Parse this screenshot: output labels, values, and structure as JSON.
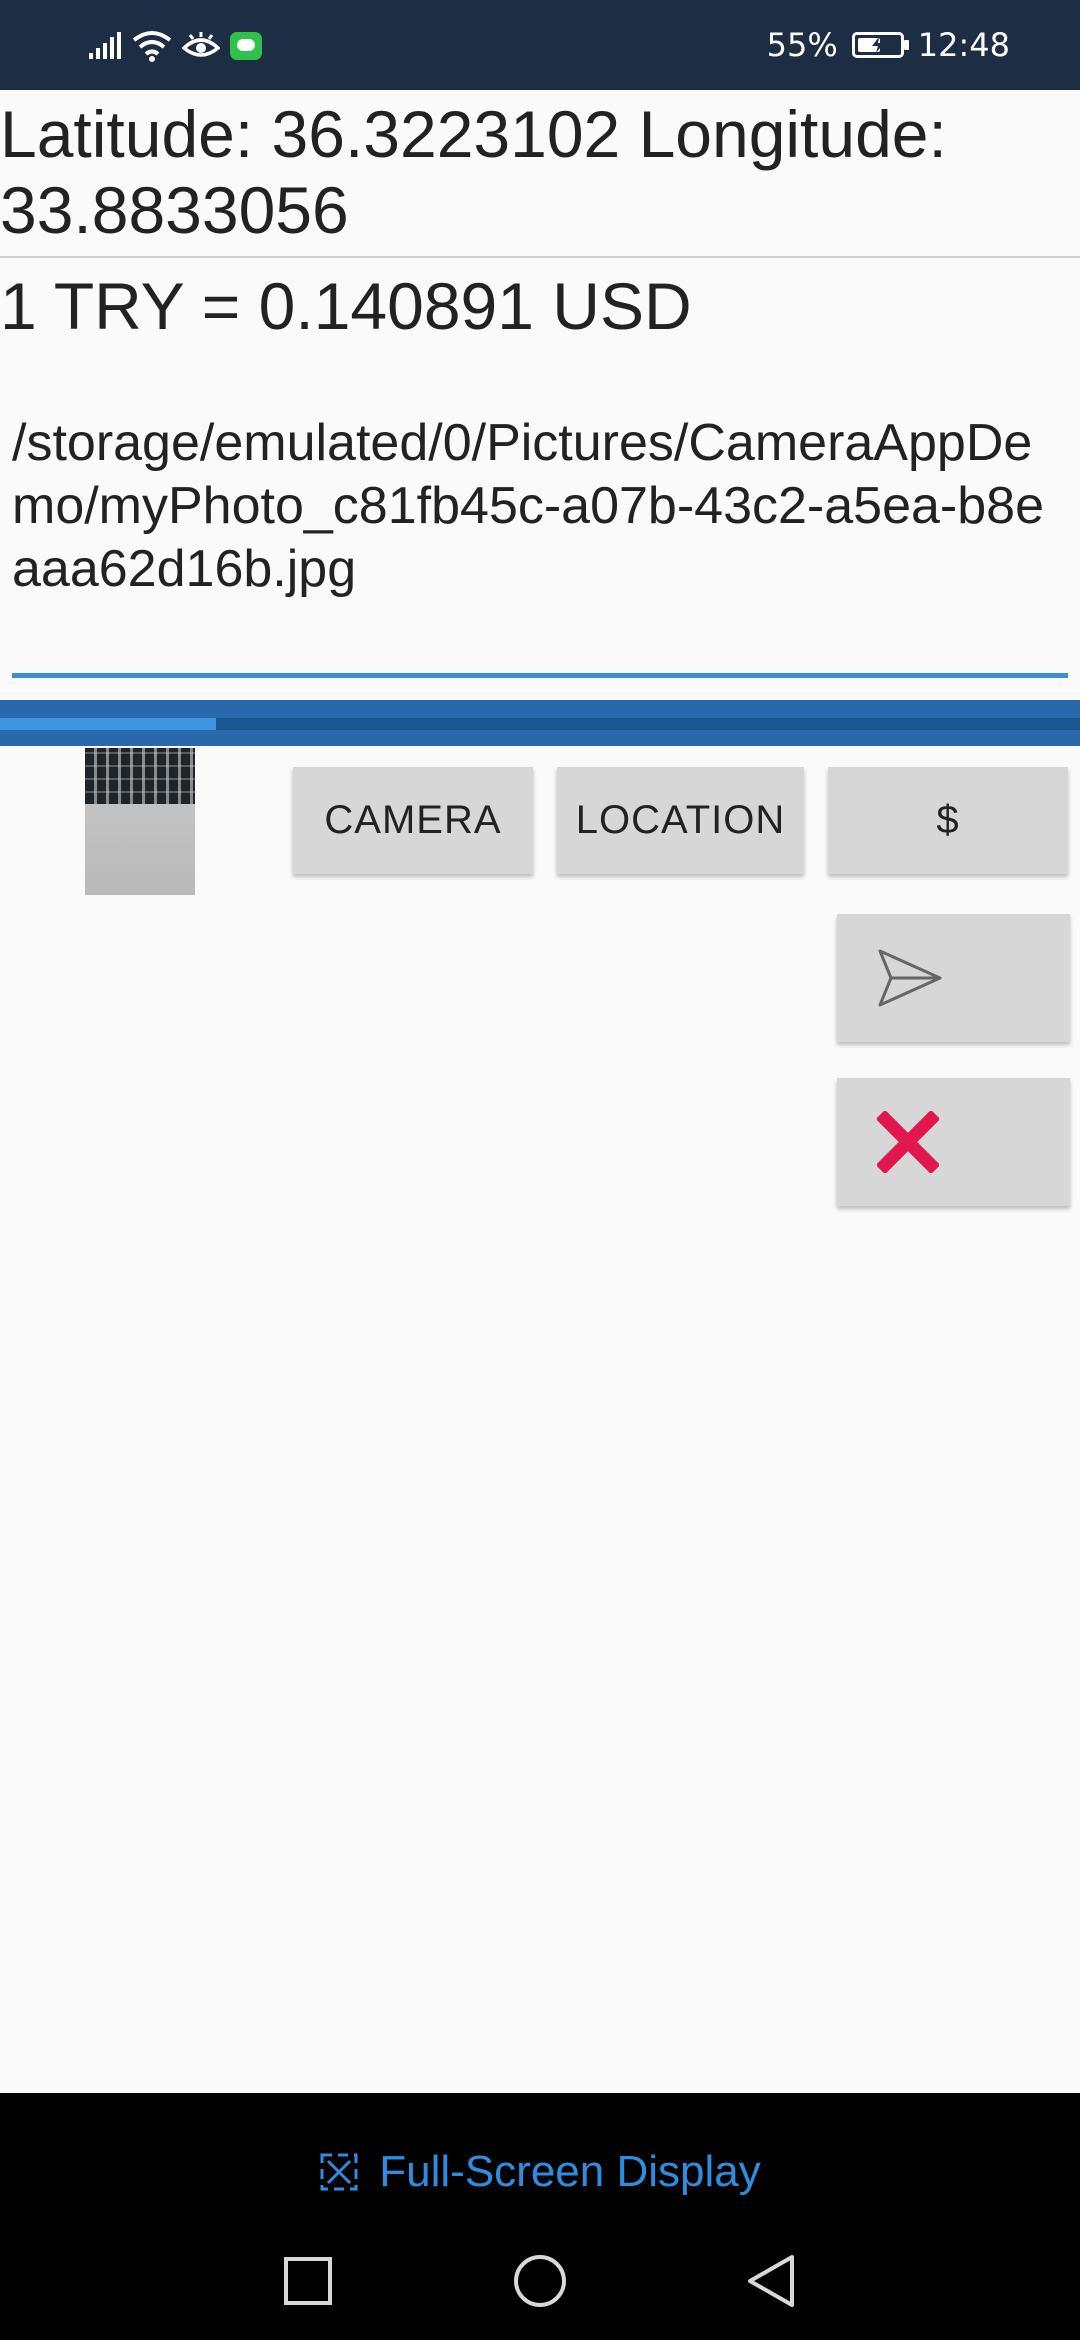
{
  "status_bar": {
    "battery_percent": "55%",
    "battery_level": 0.55,
    "time": "12:48",
    "icons": [
      "signal-icon",
      "wifi-icon",
      "eye-comfort-icon",
      "message-icon",
      "battery-icon"
    ]
  },
  "location": {
    "text": "Latitude: 36.3223102 Longitude: 33.8833056"
  },
  "currency": {
    "text": "1 TRY = 0.140891 USD"
  },
  "photo_path": {
    "value": "/storage/emulated/0/Pictures/CameraAppDemo/myPhoto_c81fb45c-a07b-43c2-a5ea-b8eaaa62d16b.jpg"
  },
  "progress": {
    "value": 0.2
  },
  "buttons": {
    "camera_label": "CAMERA",
    "location_label": "LOCATION",
    "currency_label": "$",
    "send_icon": "send-icon",
    "close_icon": "close-icon"
  },
  "fullscreen": {
    "label": "Full-Screen Display",
    "icon": "fullscreen-icon"
  },
  "navigation": {
    "items": [
      "recents-icon",
      "home-icon",
      "back-icon"
    ]
  },
  "colors": {
    "status_bar": "#1d2d44",
    "accent": "#3a8fd3",
    "close_red": "#e3174f",
    "fullscreen_link": "#2f8de0"
  }
}
